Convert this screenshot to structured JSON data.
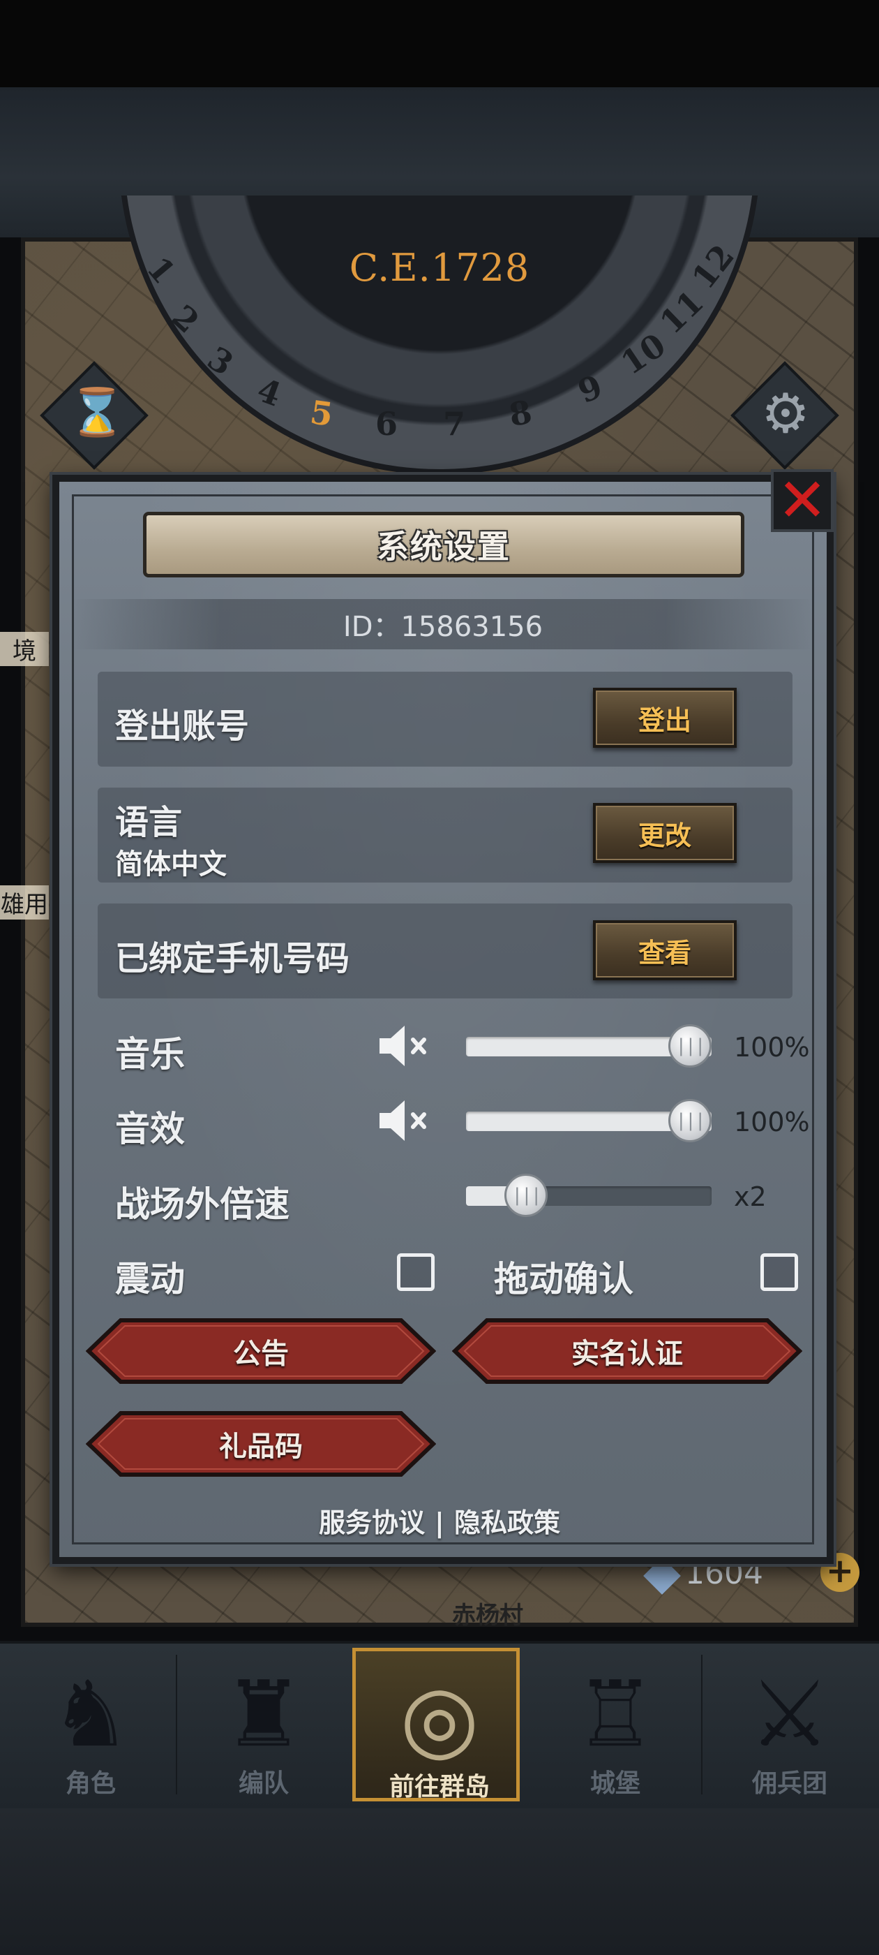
{
  "header": {
    "year": "C.E.1728",
    "wheel_numbers": [
      "1",
      "2",
      "3",
      "4",
      "5",
      "6",
      "7",
      "8",
      "9",
      "10",
      "11",
      "12"
    ],
    "current_month": "5"
  },
  "dialog": {
    "title": "系统设置",
    "id_text": "ID：15863156",
    "close_icon": "close-x-icon",
    "rows": {
      "logout": {
        "label": "登出账号",
        "button": "登出"
      },
      "language": {
        "label": "语言",
        "value": "简体中文",
        "button": "更改"
      },
      "phone": {
        "label": "已绑定手机号码",
        "button": "查看"
      }
    },
    "music": {
      "label": "音乐",
      "value_text": "100%",
      "level": 1.0,
      "icon": "mute-icon"
    },
    "sfx": {
      "label": "音效",
      "value_text": "100%",
      "level": 1.0,
      "icon": "mute-icon"
    },
    "speed": {
      "label": "战场外倍速",
      "value_text": "x2",
      "level": 0.19
    },
    "vibration": {
      "label": "震动",
      "checked": false
    },
    "drag_confirm": {
      "label": "拖动确认",
      "checked": false
    },
    "buttons": {
      "notice": "公告",
      "realname": "实名认证",
      "giftcode": "礼品码"
    },
    "footer": {
      "service": "服务协议",
      "separator": "|",
      "privacy": "隐私政策"
    }
  },
  "background": {
    "resource_count": "1604",
    "village": "赤杨村",
    "left_edge": [
      "境",
      "雄用"
    ]
  },
  "bottom_nav": [
    {
      "label": "角色",
      "icon": "knight-helmet-icon"
    },
    {
      "label": "编队",
      "icon": "team-icon"
    },
    {
      "label": "前往群岛",
      "icon": "globe-compass-icon",
      "active": true
    },
    {
      "label": "城堡",
      "icon": "castle-icon"
    },
    {
      "label": "佣兵团",
      "icon": "mercenary-icon"
    }
  ],
  "colors": {
    "accent_gold": "#f6bf55",
    "close_red": "#d01e1e",
    "year_orange": "#e19a3e",
    "red_button": "#8a2a24"
  }
}
